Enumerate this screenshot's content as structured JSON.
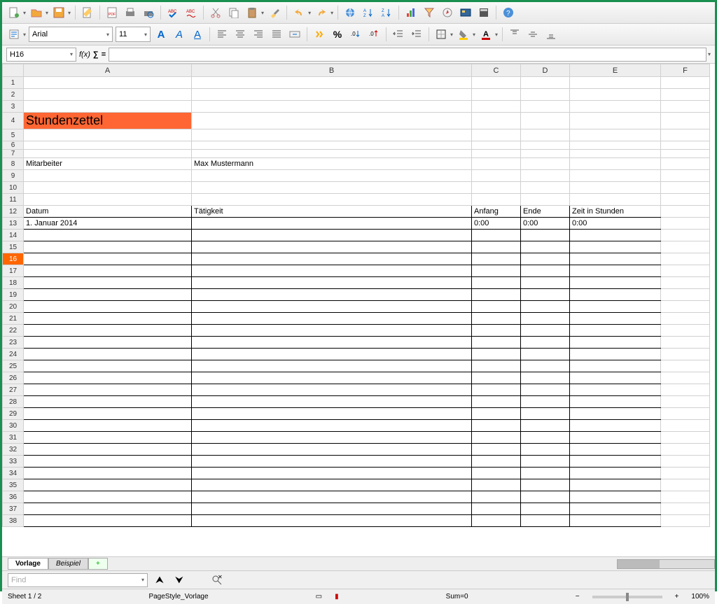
{
  "formatbar": {
    "font": "Arial",
    "size": "11"
  },
  "formula": {
    "cellref": "H16",
    "fx": "f(x)",
    "sigma": "∑",
    "eq": "="
  },
  "columns": [
    "A",
    "B",
    "C",
    "D",
    "E",
    "F"
  ],
  "rows": [
    1,
    2,
    3,
    4,
    5,
    6,
    7,
    8,
    9,
    10,
    11,
    12,
    13,
    14,
    15,
    16,
    17,
    18,
    19,
    20,
    21,
    22,
    23,
    24,
    25,
    26,
    27,
    28,
    29,
    30,
    31,
    32,
    33,
    34,
    35,
    36,
    37,
    38
  ],
  "active_row": 16,
  "cells": {
    "title": "Stundenzettel",
    "mitarbeiter_label": "Mitarbeiter",
    "mitarbeiter_value": "Max Mustermann",
    "headers": {
      "datum": "Datum",
      "taetigkeit": "Tätigkeit",
      "anfang": "Anfang",
      "ende": "Ende",
      "zeit": "Zeit in Stunden"
    },
    "row13": {
      "datum": "1. Januar 2014",
      "anfang": "0:00",
      "ende": "0:00",
      "zeit": "0:00"
    }
  },
  "tabs": {
    "active": "Vorlage",
    "other": "Beispiel",
    "add": "+"
  },
  "find": {
    "placeholder": "Find"
  },
  "status": {
    "sheet": "Sheet 1 / 2",
    "style": "PageStyle_Vorlage",
    "sum": "Sum=0",
    "zoom": "100%"
  }
}
